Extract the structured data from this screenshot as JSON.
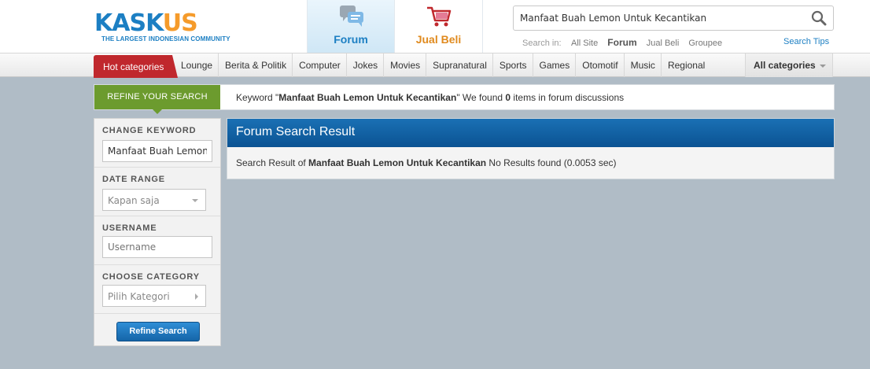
{
  "header": {
    "logo_text_main": "KASK",
    "logo_text_accent": "US",
    "logo_tagline": "THE LARGEST INDONESIAN COMMUNITY",
    "tabs": [
      {
        "label": "Forum",
        "icon": "forum-icon"
      },
      {
        "label": "Jual Beli",
        "icon": "shopping-cart-icon"
      }
    ],
    "search": {
      "value": "Manfaat Buah Lemon Untuk Kecantikan",
      "search_in_label": "Search in:",
      "options": [
        "All Site",
        "Forum",
        "Jual Beli",
        "Groupee"
      ],
      "active_option": "Forum",
      "tips_label": "Search Tips"
    }
  },
  "nav": {
    "hot_label": "Hot categories",
    "items": [
      "Lounge",
      "Berita & Politik",
      "Computer",
      "Jokes",
      "Movies",
      "Supranatural",
      "Sports",
      "Games",
      "Otomotif",
      "Music",
      "Regional"
    ],
    "all_label": "All categories"
  },
  "refine_bar": {
    "tag": "REFINE YOUR SEARCH",
    "prefix": "Keyword \"",
    "keyword": "Manfaat Buah Lemon Untuk Kecantikan",
    "middle": "\" We found ",
    "count": "0",
    "suffix": " items in forum discussions"
  },
  "sidebar": {
    "change_keyword_label": "CHANGE KEYWORD",
    "keyword_value": "Manfaat Buah Lemon Untuk Kecantikan",
    "date_range_label": "DATE RANGE",
    "date_range_value": "Kapan saja",
    "username_label": "USERNAME",
    "username_placeholder": "Username",
    "category_label": "CHOOSE CATEGORY",
    "category_value": "Pilih Kategori",
    "refine_button": "Refine Search"
  },
  "result": {
    "title": "Forum Search Result",
    "prefix": "Search Result of ",
    "keyword": "Manfaat Buah Lemon Untuk Kecantikan",
    "suffix": " No Results found (0.0053 sec)"
  },
  "colors": {
    "brand_blue": "#1c7fc3",
    "brand_orange": "#f59b2b",
    "hot_red": "#c0282d",
    "refine_green": "#6c9b2e",
    "page_bg": "#b0bcc6"
  }
}
